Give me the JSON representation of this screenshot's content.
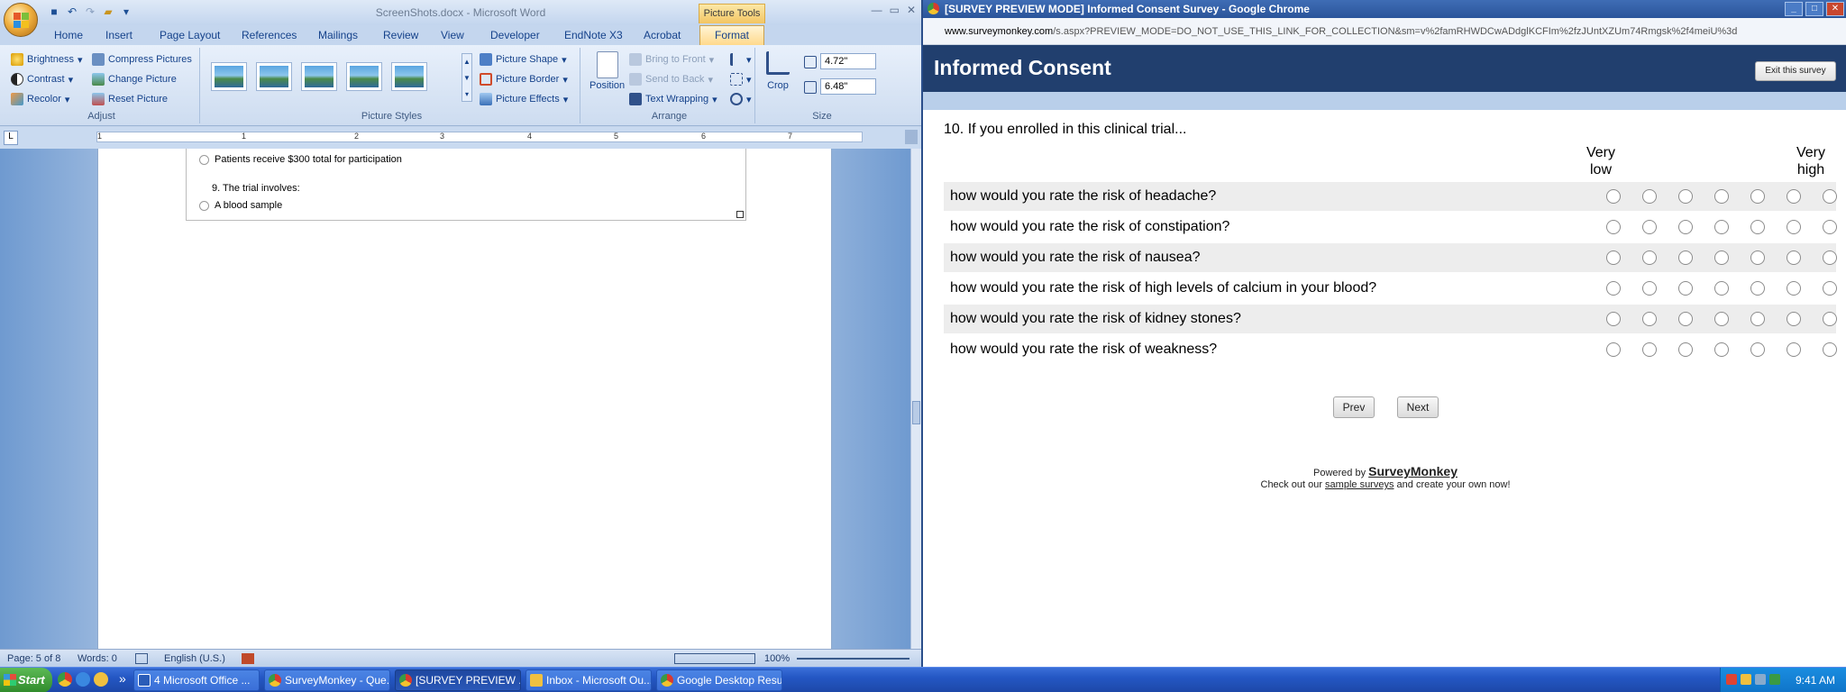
{
  "word": {
    "window_title": "ScreenShots.docx - Microsoft Word",
    "contextual_tab": "Picture Tools",
    "tabs": [
      "Home",
      "Insert",
      "Page Layout",
      "References",
      "Mailings",
      "Review",
      "View",
      "Developer",
      "EndNote X3",
      "Acrobat"
    ],
    "active_tab": "Format",
    "ribbon": {
      "adjust": {
        "brightness": "Brightness",
        "contrast": "Contrast",
        "recolor": "Recolor",
        "compress": "Compress Pictures",
        "change": "Change Picture",
        "reset": "Reset Picture",
        "title": "Adjust"
      },
      "styles": {
        "shape": "Picture Shape",
        "border": "Picture Border",
        "effects": "Picture Effects",
        "title": "Picture Styles"
      },
      "arrange": {
        "bring_front": "Bring to Front",
        "send_back": "Send to Back",
        "wrapping": "Text Wrapping",
        "position": "Position",
        "title": "Arrange"
      },
      "size": {
        "crop": "Crop",
        "height": "4.72\"",
        "width": "6.48\"",
        "title": "Size"
      }
    },
    "ruler_numbers": [
      "1",
      "1",
      "2",
      "3",
      "4",
      "5",
      "6",
      "7"
    ],
    "doc": {
      "line1": "Patients receive $300 total for participation",
      "line2": "9. The trial involves:",
      "line3": "A blood sample"
    },
    "status": {
      "page": "Page: 5 of 8",
      "words": "Words: 0",
      "language": "English (U.S.)",
      "zoom": "100%"
    }
  },
  "chrome": {
    "window_title": "[SURVEY PREVIEW MODE] Informed Consent Survey - Google Chrome",
    "url_host": "www.surveymonkey.com",
    "url_path": "/s.aspx?PREVIEW_MODE=DO_NOT_USE_THIS_LINK_FOR_COLLECTION&sm=v%2famRHWDCwADdglKCFIm%2fzJUntXZUm74Rmgsk%2f4meiU%3d",
    "survey": {
      "header": "Informed Consent",
      "exit": "Exit this survey",
      "question": "10. If you enrolled in this clinical trial...",
      "scale_low": "Very low",
      "scale_high": "Very high",
      "rows": [
        "how would you rate the risk of headache?",
        "how would you rate the risk of constipation?",
        "how would you rate the risk of nausea?",
        "how would you rate the risk of high levels of calcium in your blood?",
        "how would you rate the risk of kidney stones?",
        "how would you rate the risk of weakness?"
      ],
      "prev": "Prev",
      "next": "Next",
      "powered_prefix": "Powered by",
      "brand": "SurveyMonkey",
      "checkout_pre": "Check out our",
      "checkout_link": "sample surveys",
      "checkout_post": "and create your own now!"
    }
  },
  "taskbar": {
    "start": "Start",
    "tasks": [
      "4 Microsoft Office ...",
      "SurveyMonkey - Que...",
      "[SURVEY PREVIEW ...",
      "Inbox - Microsoft Ou...",
      "Google Desktop Results"
    ],
    "clock": "9:41 AM"
  }
}
